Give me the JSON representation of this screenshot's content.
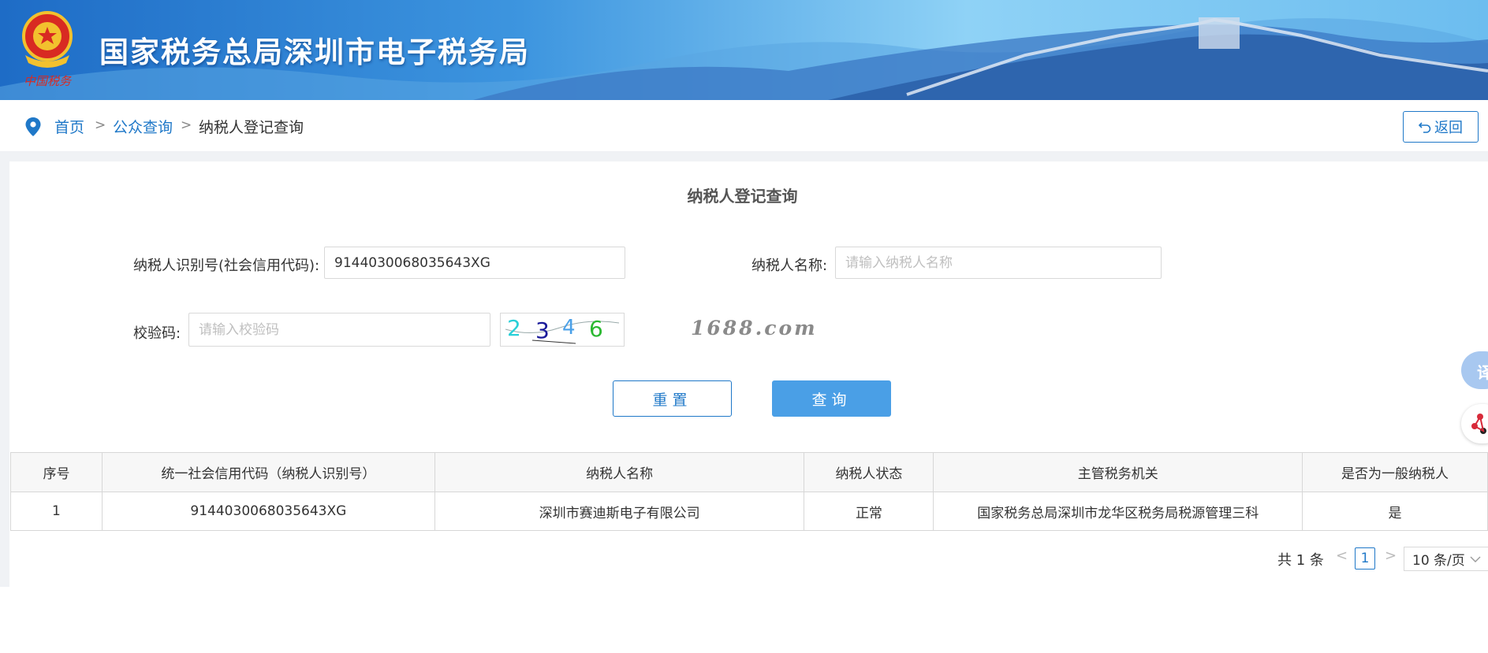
{
  "header": {
    "site_title": "国家税务总局深圳市电子税务局",
    "emblem_text": "中国税务",
    "accent_color": "#2c86dc"
  },
  "breadcrumb": {
    "home": "首页",
    "public_query": "公众查询",
    "current": "纳税人登记查询",
    "separator": ">",
    "back_label": "返回"
  },
  "form": {
    "title": "纳税人登记查询",
    "taxpayer_id_label": "纳税人识别号(社会信用代码):",
    "taxpayer_id_value": "914403006803​5643XG",
    "taxpayer_name_label": "纳税人名称:",
    "taxpayer_name_placeholder": "请输入纳税人名称",
    "captcha_label": "校验码:",
    "captcha_placeholder": "请输入校验码",
    "captcha_chars": [
      "2",
      "3",
      "4",
      "6"
    ],
    "watermark": "1688.com",
    "reset_label": "重置",
    "query_label": "查询"
  },
  "table": {
    "headers": [
      "序号",
      "统一社会信用代码（纳税人识别号）",
      "纳税人名称",
      "纳税人状态",
      "主管税务机关",
      "是否为一般纳税人"
    ],
    "rows": [
      [
        "1",
        "9144030068035643XG",
        "深圳市赛迪斯电子有限公司",
        "正常",
        "国家税务总局深圳市龙华区税务局税源管理三科",
        "是"
      ]
    ]
  },
  "pagination": {
    "total": "共 1 条",
    "prev": "<",
    "current_page": "1",
    "next": ">",
    "page_size": "10 条/页"
  },
  "floating": {
    "chat_glyph": "译"
  }
}
